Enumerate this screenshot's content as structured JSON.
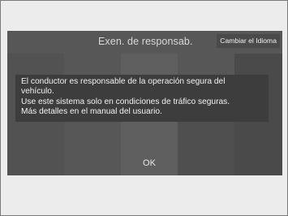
{
  "dialog": {
    "title": "Exen. de responsab.",
    "language_button": "Cambiar el Idioma",
    "message_lines": [
      "El conductor es responsable de la operación segura del",
      "vehículo.",
      "Use este sistema solo en condiciones de tráfico seguras.",
      "Más detalles en el manual del usuario."
    ],
    "ok_button": "OK"
  }
}
